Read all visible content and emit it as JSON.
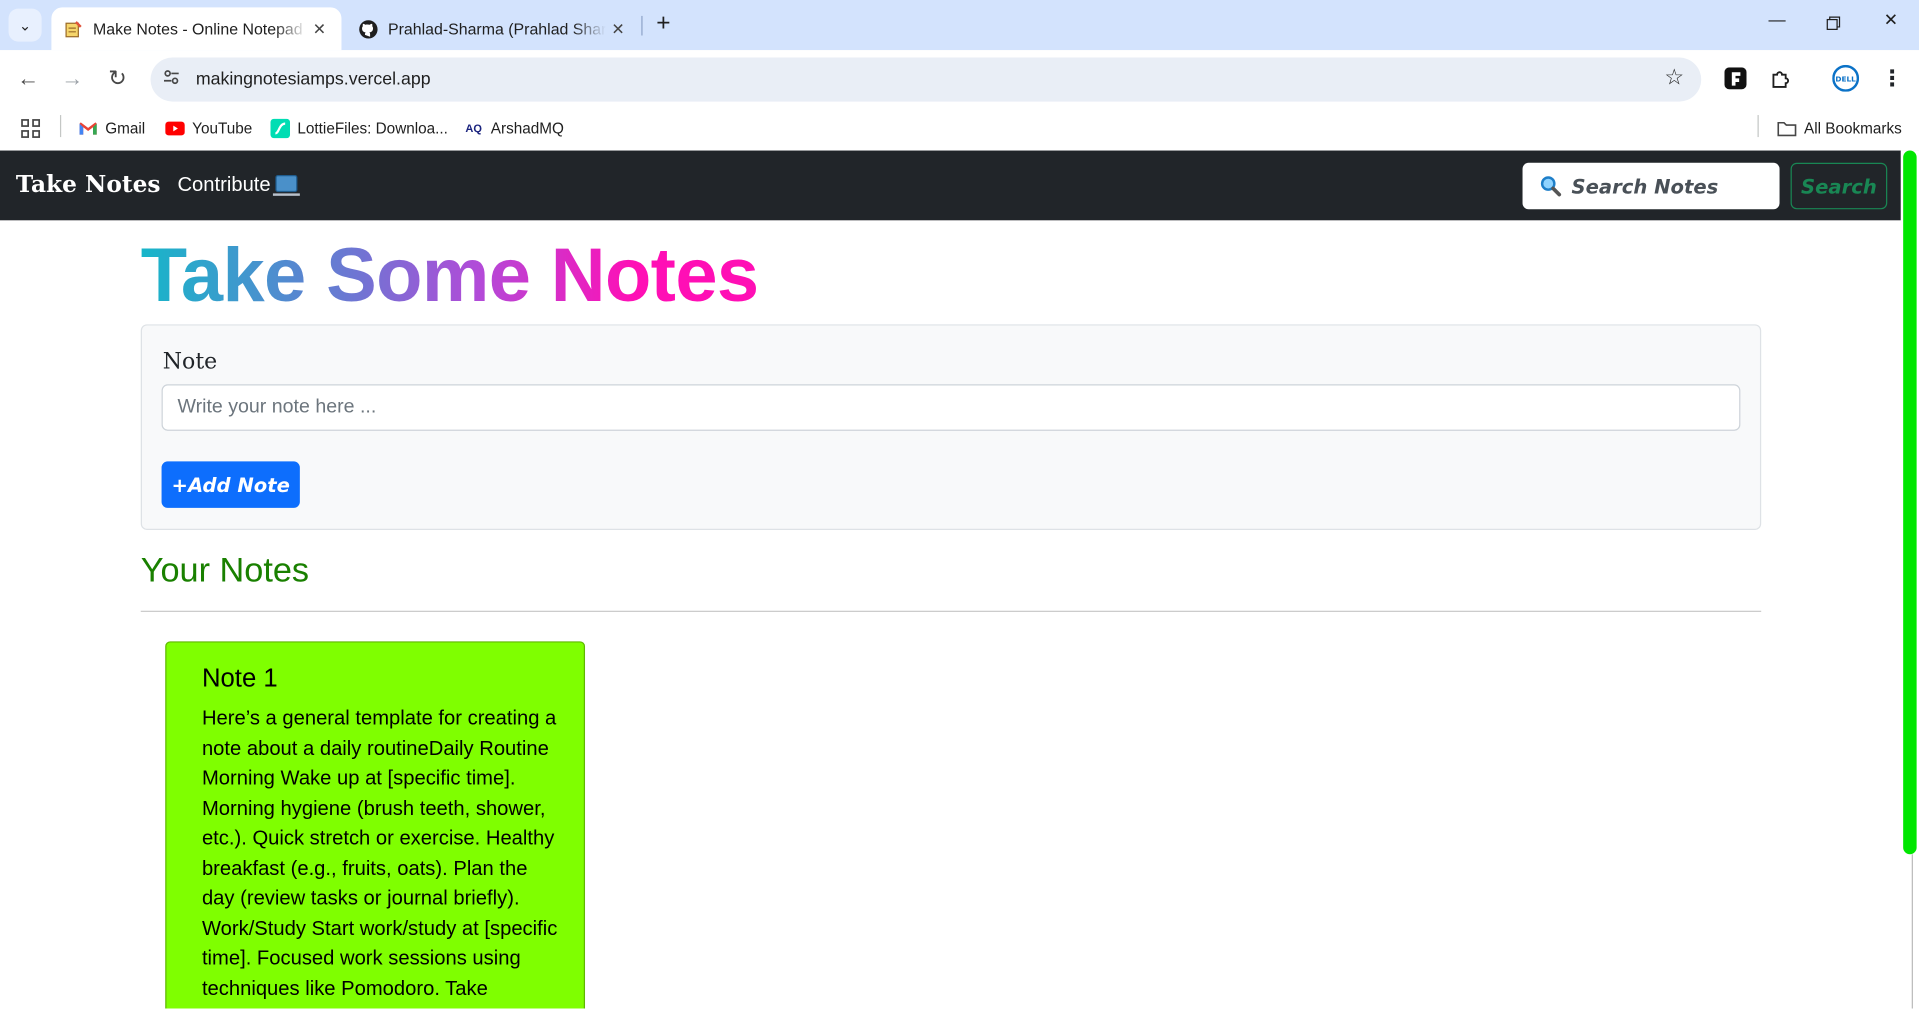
{
  "browser": {
    "tabs": [
      {
        "title": "Make Notes - Online Notepad /",
        "favicon": "notepad-icon",
        "active": true
      },
      {
        "title": "Prahlad-Sharma (Prahlad Sharma)",
        "favicon": "github-icon",
        "active": false
      }
    ],
    "url": "makingnotesiamps.vercel.app",
    "bookmarks": [
      {
        "label": "Gmail",
        "icon": "gmail-icon"
      },
      {
        "label": "YouTube",
        "icon": "youtube-icon"
      },
      {
        "label": "LottieFiles: Downloa...",
        "icon": "lottiefiles-icon"
      },
      {
        "label": "ArshadMQ",
        "icon": "arshadmq-icon"
      }
    ],
    "all_bookmarks": "All Bookmarks",
    "profile_badge": "DELL"
  },
  "navbar": {
    "brand": "Take Notes",
    "contribute": "Contribute",
    "search_placeholder": "Search Notes",
    "search_button": "Search"
  },
  "main": {
    "heading": "Take Some Notes",
    "note_label": "Note",
    "note_placeholder": "Write your note here ...",
    "add_button": "+Add Note",
    "your_notes_heading": "Your Notes"
  },
  "notes": [
    {
      "title": "Note 1",
      "body": "Here’s a general template for creating a note about a daily routineDaily Routine Morning Wake up at [specific time]. Morning hygiene (brush teeth, shower, etc.). Quick stretch or exercise. Healthy breakfast (e.g., fruits, oats). Plan the day (review tasks or journal briefly). Work/Study Start work/study at [specific time]. Focused work sessions using techniques like Pomodoro. Take",
      "color": "#7fff00"
    }
  ],
  "colors": {
    "navbar": "#212529",
    "accent_blue": "#0d6efd",
    "success_green": "#198754",
    "your_notes_green": "#198000",
    "scrollbar_thumb": "#00e600"
  }
}
